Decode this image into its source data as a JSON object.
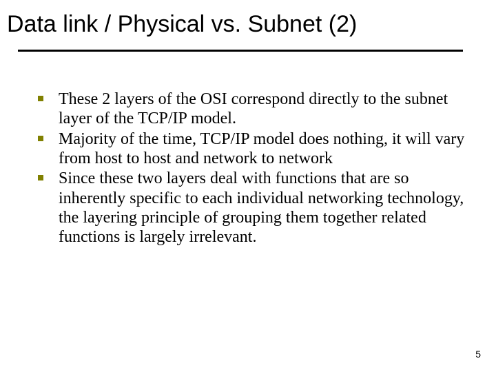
{
  "title": "Data link / Physical vs. Subnet (2)",
  "bullets": [
    "These 2 layers of the OSI correspond directly to the subnet layer of the TCP/IP model.",
    "Majority of the time, TCP/IP model does nothing, it will vary from host to host and network to network",
    "Since these two layers deal with functions that are so inherently specific to each individual networking technology, the layering principle of grouping them together related functions is largely irrelevant."
  ],
  "page_number": "5"
}
